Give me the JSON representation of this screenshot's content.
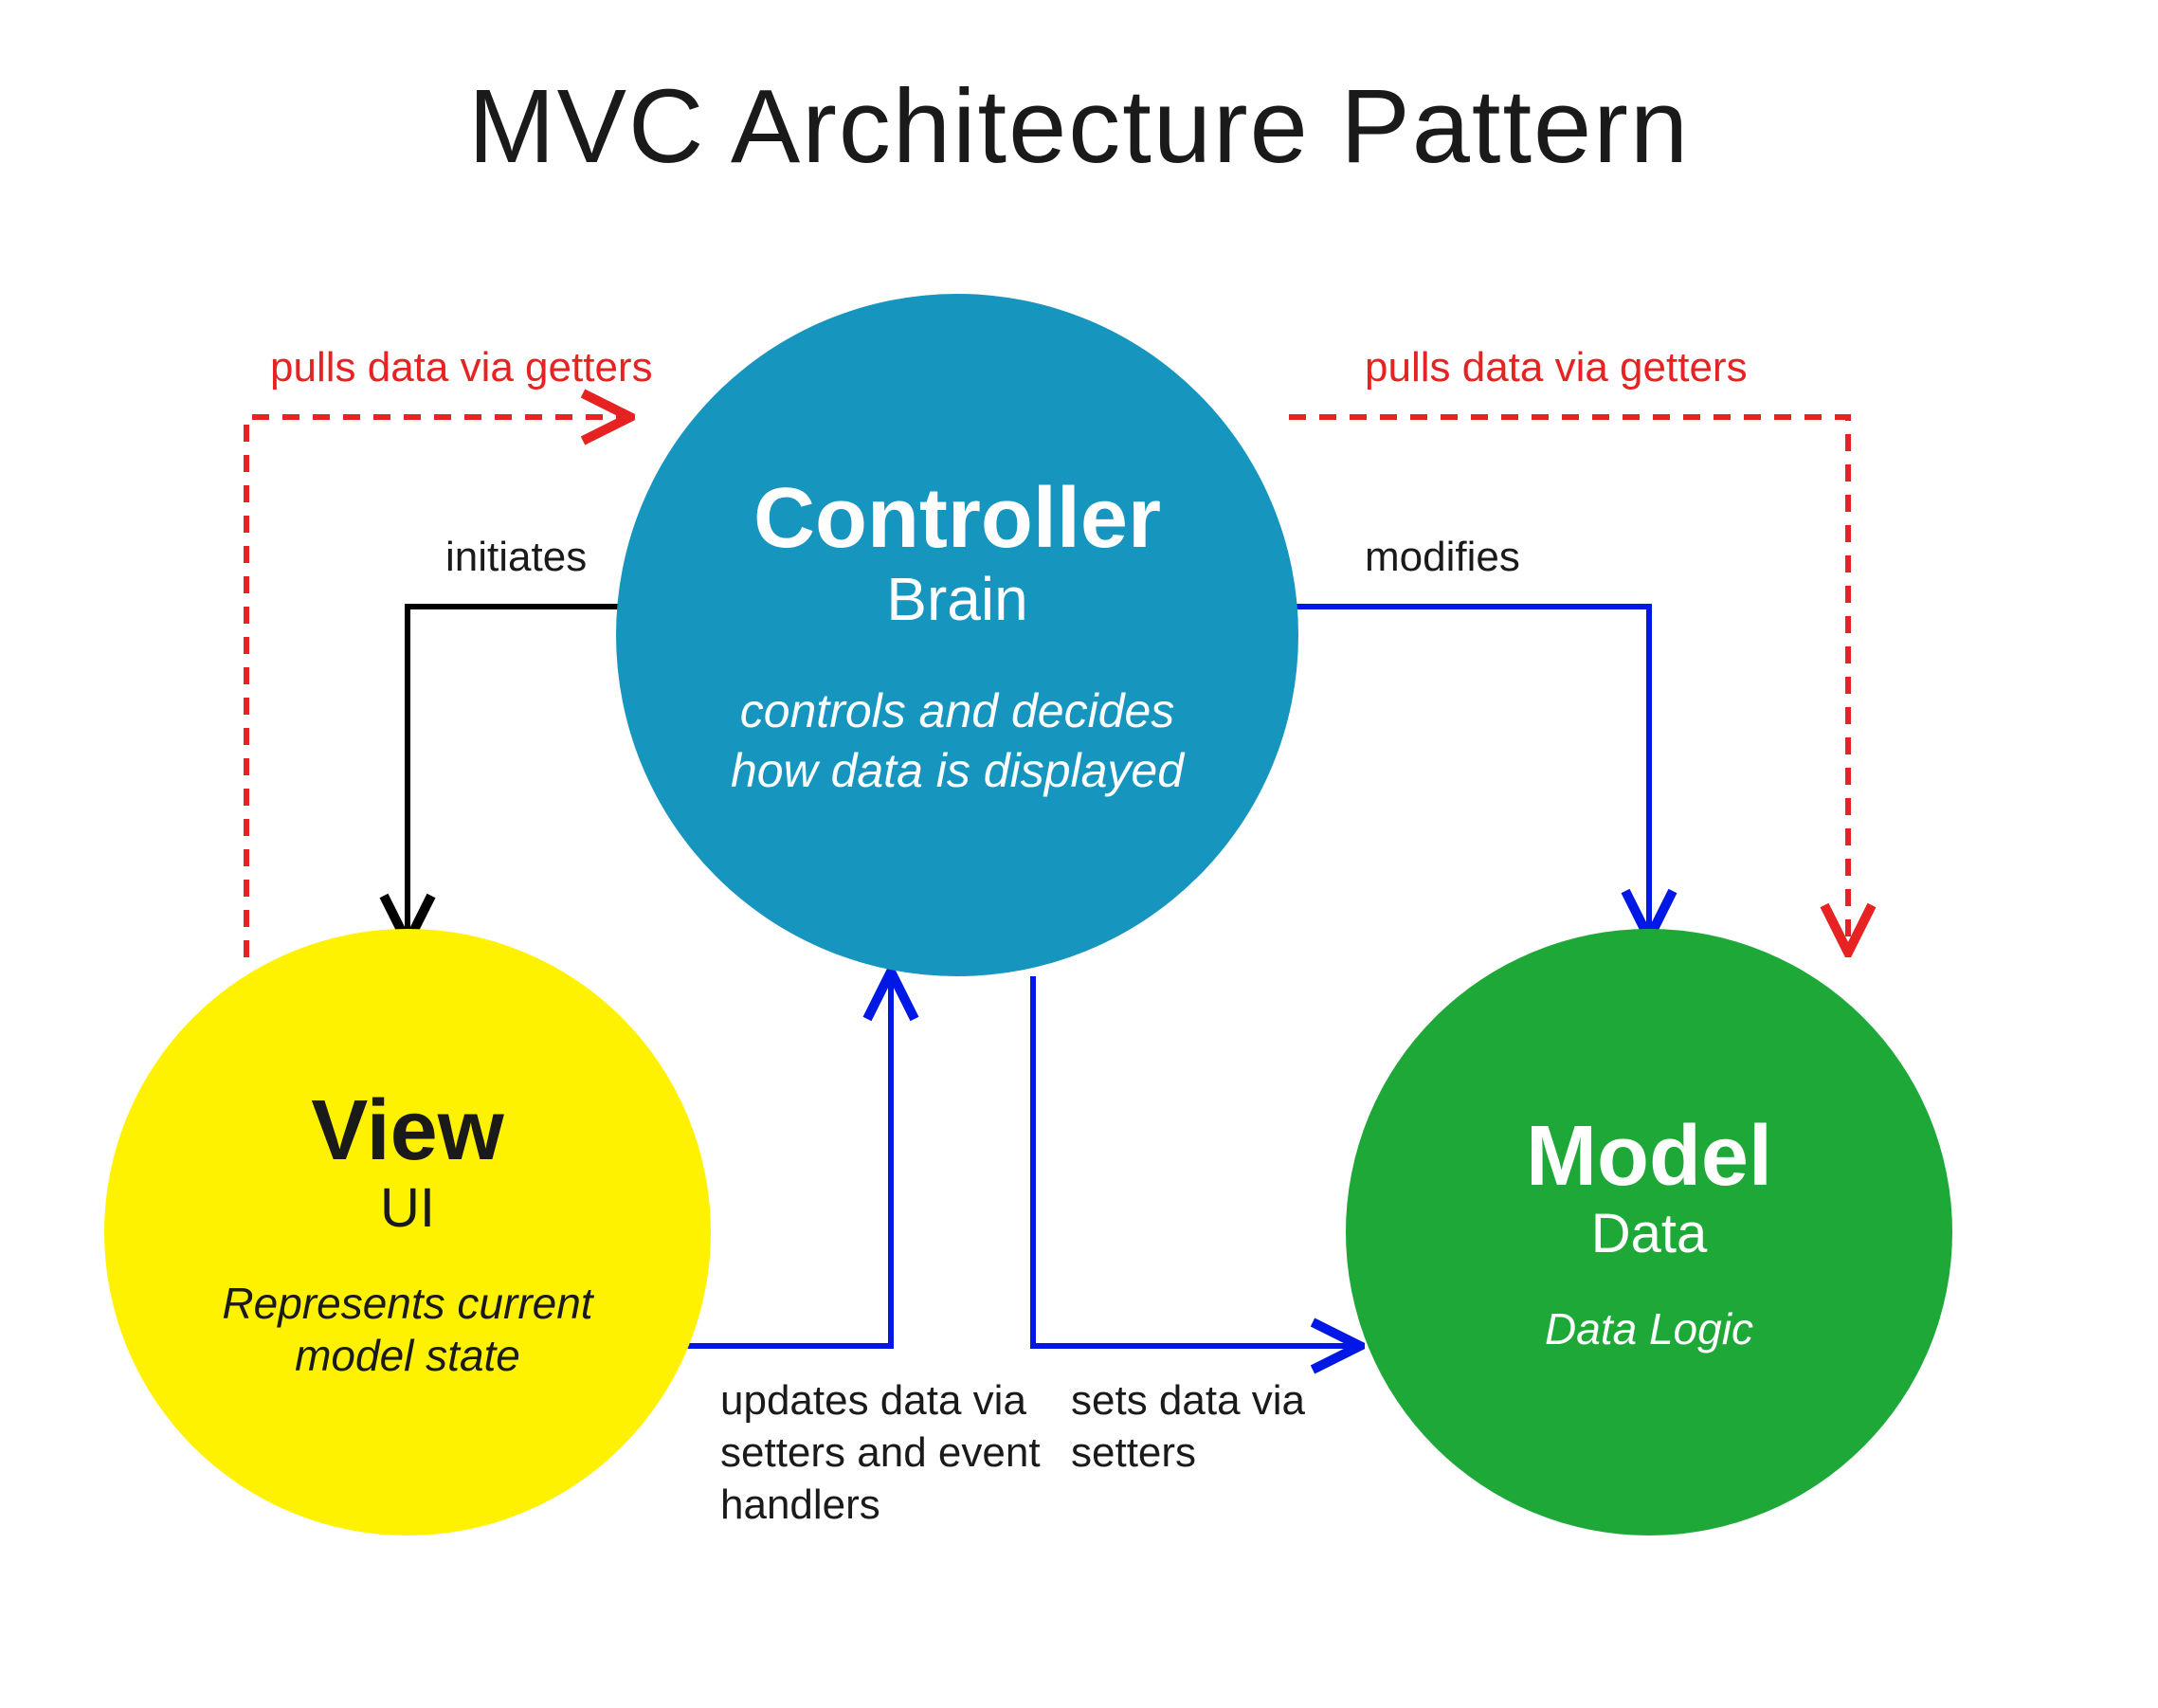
{
  "title": "MVC Architecture Pattern",
  "nodes": {
    "controller": {
      "name": "Controller",
      "role": "Brain",
      "desc": "controls and decides how data is displayed",
      "color": "#1695bf"
    },
    "view": {
      "name": "View",
      "role": "UI",
      "desc": "Represents current model state",
      "color": "#fff200"
    },
    "model": {
      "name": "Model",
      "role": "Data",
      "desc": "Data Logic",
      "color": "#1ea838"
    }
  },
  "edges": {
    "controller_to_view_getters": {
      "from": "controller",
      "to": "view",
      "label": "pulls data via getters",
      "style": "dashed",
      "color": "#e62222"
    },
    "controller_to_model_getters": {
      "from": "controller",
      "to": "model",
      "label": "pulls data via getters",
      "style": "dashed",
      "color": "#e62222"
    },
    "controller_to_view_initiates": {
      "from": "controller",
      "to": "view",
      "label": "initiates",
      "style": "solid",
      "color": "#000000"
    },
    "controller_to_model_modifies": {
      "from": "controller",
      "to": "model",
      "label": "modifies",
      "style": "solid",
      "color": "#0018e6"
    },
    "view_to_controller_updates": {
      "from": "view",
      "to": "controller",
      "label": "updates data via setters and event handlers",
      "style": "solid",
      "color": "#0018e6"
    },
    "controller_to_model_sets": {
      "from": "controller",
      "to": "model",
      "label": "sets data via setters",
      "style": "solid",
      "color": "#0018e6"
    }
  }
}
